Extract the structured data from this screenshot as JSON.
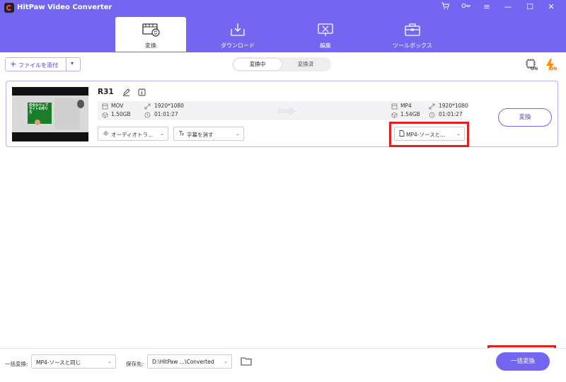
{
  "app": {
    "title": "HitPaw Video Converter"
  },
  "tabs": [
    {
      "label": "変換",
      "active": true
    },
    {
      "label": "ダウンロード",
      "active": false
    },
    {
      "label": "編集",
      "active": false
    },
    {
      "label": "ツールボックス",
      "active": false
    }
  ],
  "toolbar": {
    "add_file_label": "ファイルを添付",
    "seg_converting": "変換中",
    "seg_converted": "変換済",
    "hw_accel_badge": "ON"
  },
  "file": {
    "name": "R31",
    "thumbnail_text": "安全なウェブサイトの作り方",
    "source": {
      "format": "MOV",
      "resolution": "1920*1080",
      "size": "1.50GB",
      "duration": "01:01:27"
    },
    "output": {
      "format": "MP4",
      "resolution": "1920*1080",
      "size": "1.54GB",
      "duration": "01:01:27"
    },
    "audio_track": "オーディオトラ...",
    "subtitle": "字幕を消す",
    "output_format_select": "MP4-ソースと...",
    "convert_label": "変換"
  },
  "bottom": {
    "batch_label": "一括変換:",
    "batch_value": "MP4-ソースと同じ",
    "save_label": "保存先:",
    "save_path": "D:\\HitPaw ...\\Converted",
    "batch_button": "一括変換"
  },
  "colors": {
    "accent": "#7566f2",
    "highlight": "#e02020"
  }
}
